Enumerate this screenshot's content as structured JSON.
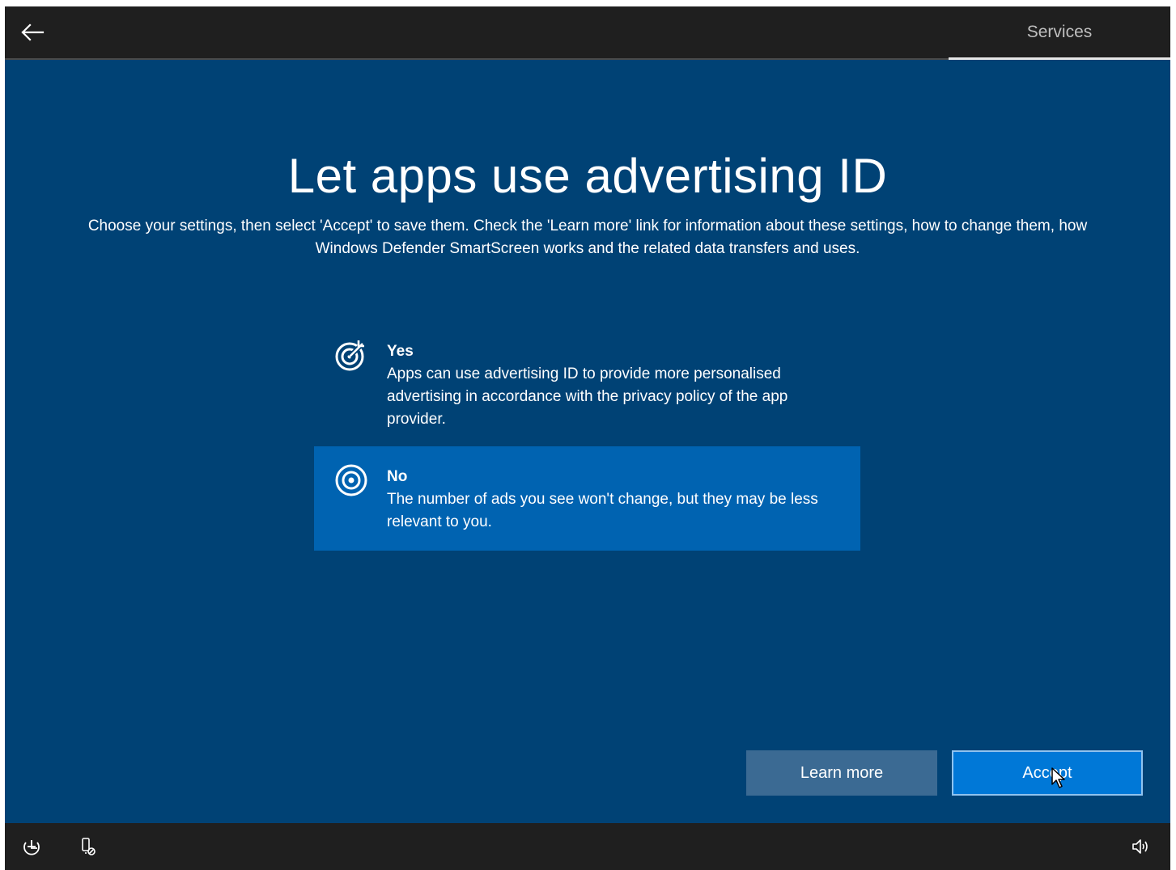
{
  "header": {
    "back_icon": "arrow-left-icon",
    "tab_label": "Services"
  },
  "main": {
    "title": "Let apps use advertising ID",
    "subtitle": "Choose your settings, then select 'Accept' to save them. Check the 'Learn more' link for information about these settings, how to change them, how Windows Defender SmartScreen works and the related data transfers and uses."
  },
  "options": [
    {
      "icon": "target-arrow-icon",
      "title": "Yes",
      "description": "Apps can use advertising ID to provide more personalised advertising in accordance with the privacy policy of the app provider.",
      "selected": false
    },
    {
      "icon": "target-icon",
      "title": "No",
      "description": "The number of ads you see won't change, but they may be less relevant to you.",
      "selected": true
    }
  ],
  "buttons": {
    "learn_more": "Learn more",
    "accept": "Accept"
  },
  "taskbar": {
    "left_icons": [
      "ease-of-access-icon",
      "network-icon"
    ],
    "right_icons": [
      "volume-icon"
    ]
  },
  "colors": {
    "background": "#004275",
    "bar": "#1f1f1f",
    "selected_option": "#0063b1",
    "accept_button": "#0078d7",
    "learn_more_button": "#3b6a93"
  }
}
